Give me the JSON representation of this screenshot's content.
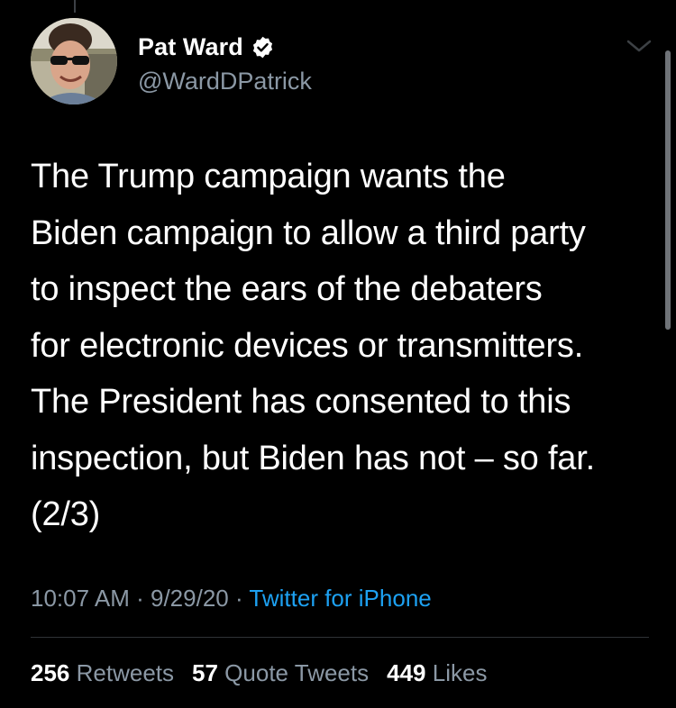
{
  "user": {
    "display_name": "Pat Ward",
    "handle": "@WardDPatrick",
    "verified": true,
    "avatar_icon": "profile-photo"
  },
  "tweet": {
    "text": "The Trump campaign wants the\nBiden campaign to allow a third party\nto inspect the ears of the debaters\nfor electronic devices or transmitters.\nThe President has consented to this\ninspection, but Biden has not – so far.\n(2/3)",
    "time": "10:07 AM",
    "separator": "·",
    "date": "9/29/20",
    "source": "Twitter for iPhone"
  },
  "stats": {
    "retweets_count": "256",
    "retweets_label": "Retweets",
    "quotes_count": "57",
    "quotes_label": "Quote Tweets",
    "likes_count": "449",
    "likes_label": "Likes"
  },
  "colors": {
    "background": "#000000",
    "text": "#ffffff",
    "secondary": "#8b98a5",
    "link": "#1da1f2",
    "divider": "#2f3336"
  }
}
